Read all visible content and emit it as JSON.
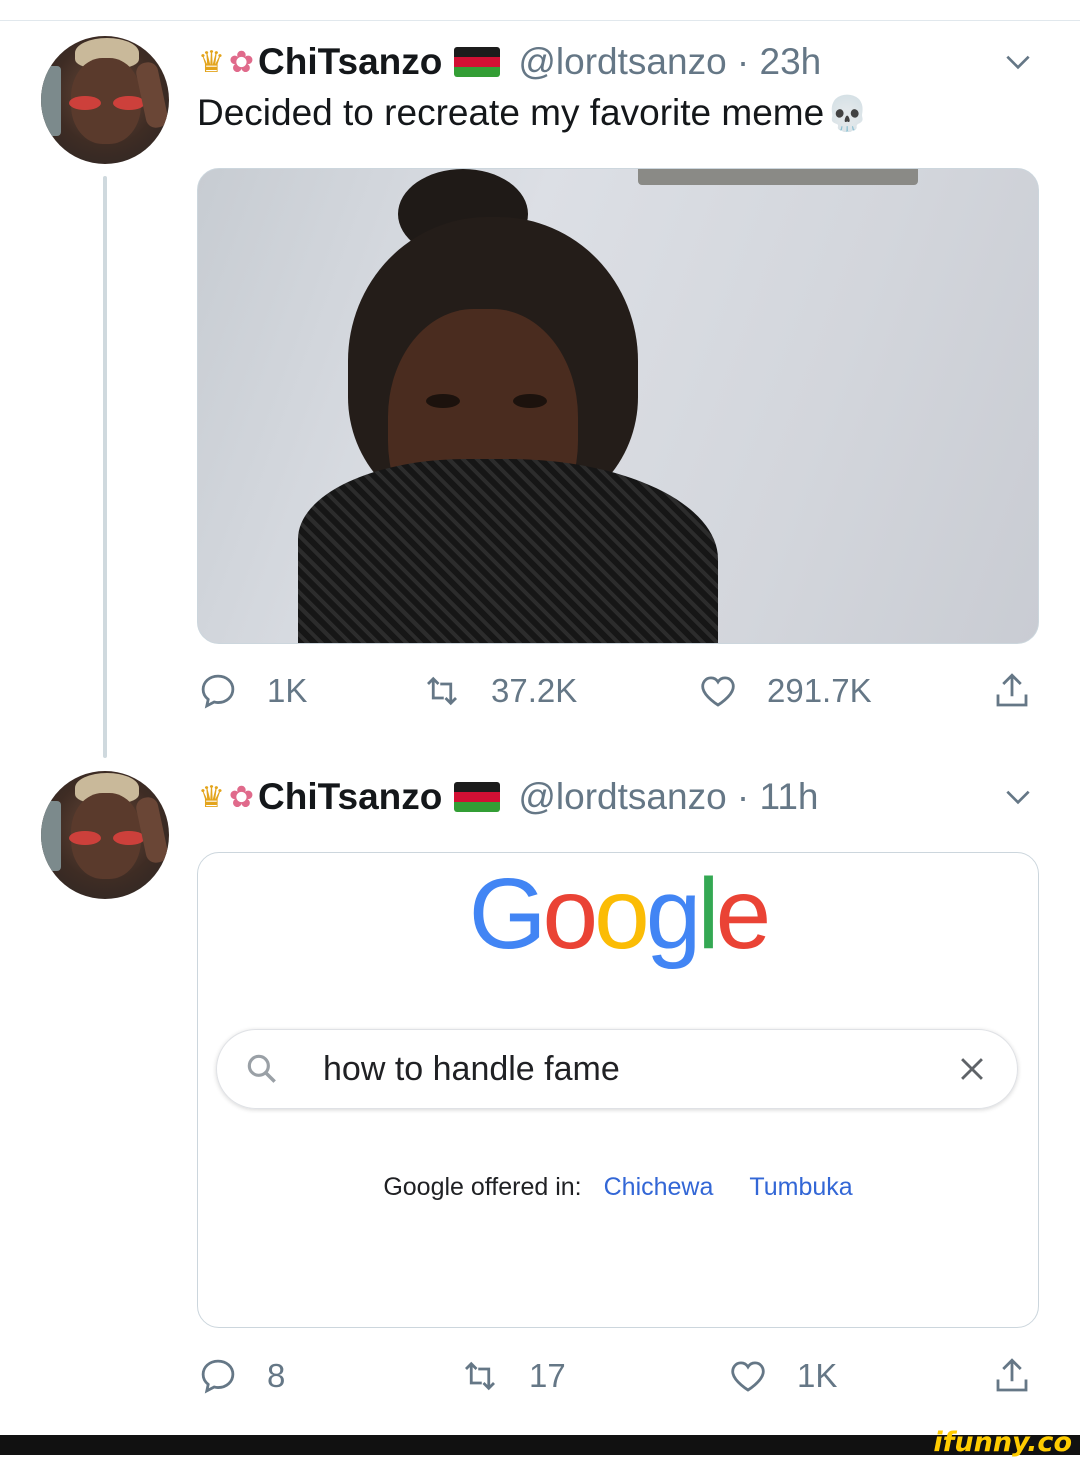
{
  "tweet1": {
    "display_name": "ChiTsanzo",
    "handle_time": "@lordtsanzo · 23h",
    "text": "Decided to recreate my favorite meme",
    "emoji_prefix": [
      "crown",
      "hibiscus"
    ],
    "emoji_suffix": "skull",
    "stats": {
      "replies": "1K",
      "retweets": "37.2K",
      "likes": "291.7K"
    }
  },
  "tweet2": {
    "display_name": "ChiTsanzo",
    "handle_time": "@lordtsanzo · 11h",
    "stats": {
      "replies": "8",
      "retweets": "17",
      "likes": "1K"
    },
    "google": {
      "logo": [
        "G",
        "o",
        "o",
        "g",
        "l",
        "e"
      ],
      "search_query": "how to handle fame",
      "offered_label": "Google offered in:",
      "languages": [
        "Chichewa",
        "Tumbuka"
      ]
    }
  },
  "watermark": "ifunny.co",
  "colors": {
    "text": "#14171a",
    "secondary": "#657786",
    "border": "#ccd6dd",
    "google_blue": "#4285f4",
    "google_red": "#ea4335",
    "google_yellow": "#fbbc05",
    "google_green": "#34a853",
    "link": "#3367d6"
  },
  "icons": [
    "reply-icon",
    "retweet-icon",
    "like-icon",
    "share-icon",
    "chevron-down-icon",
    "search-icon",
    "clear-icon",
    "flag-icon"
  ]
}
